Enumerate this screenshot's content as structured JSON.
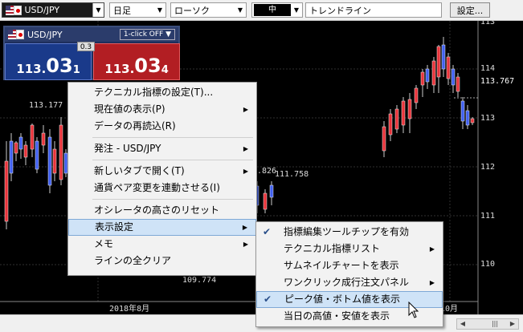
{
  "toolbar": {
    "pair": "USD/JPY",
    "timeframe": "日足",
    "chart_type": "ローソク",
    "color_label": "中",
    "tool": "トレンドライン",
    "settings_label": "設定..."
  },
  "rate_panel": {
    "pair": "USD/JPY",
    "one_click": "1-click OFF ▼",
    "spread": "0.3",
    "bid_head": "113.",
    "bid_big": "03",
    "bid_tail": "1",
    "ask_head": "113.",
    "ask_big": "03",
    "ask_tail": "4"
  },
  "chart": {
    "price_labels": [
      "113",
      "114",
      "113.767",
      "113",
      "112",
      "111",
      "110"
    ],
    "annotations": [
      "113.177",
      ".826",
      "111.758",
      "109.774"
    ],
    "date_labels": [
      "2018年8月",
      "年10月"
    ],
    "colors": {
      "up": "#e8333a",
      "down": "#4060f0",
      "background": "#000000"
    }
  },
  "context_menu": {
    "items": [
      {
        "label": "テクニカル指標の設定(T)...",
        "submenu": false
      },
      {
        "label": "現在値の表示(P)",
        "submenu": true
      },
      {
        "label": "データの再読込(R)",
        "submenu": false
      },
      {
        "label": "発注 - USD/JPY",
        "submenu": true
      },
      {
        "label": "新しいタブで開く(T)",
        "submenu": true
      },
      {
        "label": "通貨ペア変更を連動させる(I)",
        "submenu": false
      },
      {
        "label": "オシレータの高さのリセット",
        "submenu": false
      },
      {
        "label": "表示設定",
        "submenu": true
      },
      {
        "label": "メモ",
        "submenu": true
      },
      {
        "label": "ラインの全クリア",
        "submenu": false
      }
    ]
  },
  "sub_menu": {
    "items": [
      {
        "label": "指標編集ツールチップを有効",
        "checked": true,
        "submenu": false
      },
      {
        "label": "テクニカル指標リスト",
        "checked": false,
        "submenu": true
      },
      {
        "label": "サムネイルチャートを表示",
        "checked": false,
        "submenu": false
      },
      {
        "label": "ワンクリック成行注文パネル",
        "checked": false,
        "submenu": true
      },
      {
        "label": "ピーク値・ボトム値を表示",
        "checked": true,
        "submenu": false
      },
      {
        "label": "当日の高値・安値を表示",
        "checked": false,
        "submenu": false
      }
    ]
  }
}
